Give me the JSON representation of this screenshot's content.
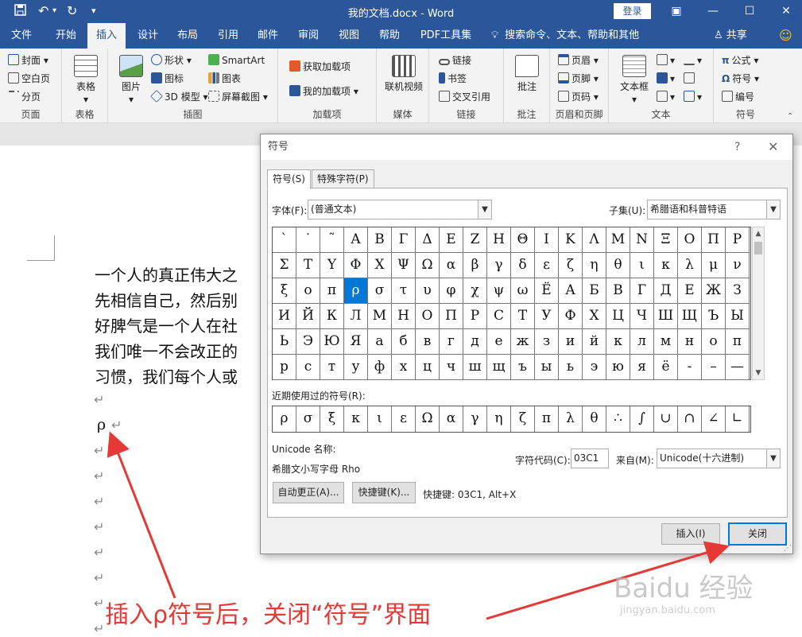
{
  "titlebar": {
    "document_title": "我的文档.docx  -  Word",
    "login_label": "登录",
    "save_icon": "save-icon",
    "undo_icon": "undo-icon",
    "redo_icon": "redo-icon",
    "qa_more": "▾",
    "ribbon_display": "▣",
    "minimize": "—",
    "maximize": "☐",
    "close": "✕"
  },
  "tabs": [
    "文件",
    "开始",
    "插入",
    "设计",
    "布局",
    "引用",
    "邮件",
    "审阅",
    "视图",
    "帮助",
    "PDF工具集"
  ],
  "tell_me": "搜索命令、文本、帮助和其他",
  "share_label": "共享",
  "ribbon": {
    "pages": {
      "label": "页面",
      "items": [
        "封面",
        "空白页",
        "分页"
      ]
    },
    "tables": {
      "label": "表格",
      "item": "表格"
    },
    "illustrations": {
      "label": "插图",
      "picture": "图片",
      "shapes": "形状",
      "icons": "图标",
      "model3d": "3D 模型",
      "smartart": "SmartArt",
      "chart": "图表",
      "screenshot": "屏幕截图"
    },
    "addins": {
      "label": "加载项",
      "get": "获取加载项",
      "mine": "我的加载项"
    },
    "media": {
      "label": "媒体",
      "video": "联机视频"
    },
    "links": {
      "label": "链接",
      "link": "链接",
      "bookmark": "书签",
      "crossref": "交叉引用"
    },
    "comments": {
      "label": "批注",
      "comment": "批注"
    },
    "header_footer": {
      "label": "页眉和页脚",
      "header": "页眉",
      "footer": "页脚",
      "page_number": "页码"
    },
    "text": {
      "label": "文本",
      "textbox": "文本框"
    },
    "symbols": {
      "label": "符号",
      "equation": "公式",
      "symbol": "符号",
      "number": "编号"
    }
  },
  "document": {
    "lines": [
      "一个人的真正伟大之",
      "先相信自己，然后别",
      "好脾气是一个人在社",
      "我们唯一不会改正的",
      "习惯，我们每个人或"
    ],
    "inserted_symbol": "ρ",
    "para_mark": "↵"
  },
  "dialog": {
    "title": "符号",
    "help": "?",
    "close": "✕",
    "tab_symbols": "符号(S)",
    "tab_special": "特殊字符(P)",
    "font_label": "字体(F):",
    "font_value": "(普通文本)",
    "subset_label": "子集(U):",
    "subset_value": "希腊语和科普特语",
    "symbols": [
      "`",
      "˙",
      "˜",
      "Α",
      "Β",
      "Γ",
      "Δ",
      "Ε",
      "Ζ",
      "Η",
      "Θ",
      "Ι",
      "Κ",
      "Λ",
      "Μ",
      "Ν",
      "Ξ",
      "Ο",
      "Π",
      "Ρ",
      "Σ",
      "Τ",
      "Υ",
      "Φ",
      "Χ",
      "Ψ",
      "Ω",
      "α",
      "β",
      "γ",
      "δ",
      "ε",
      "ζ",
      "η",
      "θ",
      "ι",
      "κ",
      "λ",
      "μ",
      "ν",
      "ξ",
      "ο",
      "π",
      "ρ",
      "σ",
      "τ",
      "υ",
      "φ",
      "χ",
      "ψ",
      "ω",
      "Ё",
      "А",
      "Б",
      "В",
      "Г",
      "Д",
      "Е",
      "Ж",
      "З",
      "И",
      "Й",
      "К",
      "Л",
      "М",
      "Н",
      "О",
      "П",
      "Р",
      "С",
      "Т",
      "У",
      "Ф",
      "Х",
      "Ц",
      "Ч",
      "Ш",
      "Щ",
      "Ъ",
      "Ы",
      "Ь",
      "Э",
      "Ю",
      "Я",
      "а",
      "б",
      "в",
      "г",
      "д",
      "е",
      "ж",
      "з",
      "и",
      "й",
      "к",
      "л",
      "м",
      "н",
      "о",
      "п",
      "р",
      "с",
      "т",
      "у",
      "ф",
      "х",
      "ц",
      "ч",
      "ш",
      "щ",
      "ъ",
      "ы",
      "ь",
      "э",
      "ю",
      "я",
      "ё",
      "‐",
      "–",
      "—"
    ],
    "selected_symbol": "ρ",
    "recent_label": "近期使用过的符号(R):",
    "recent": [
      "ρ",
      "σ",
      "ξ",
      "κ",
      "ι",
      "ε",
      "Ω",
      "α",
      "γ",
      "η",
      "ζ",
      "π",
      "λ",
      "θ",
      "∴",
      "∫",
      "∪",
      "∩",
      "∠",
      "∟"
    ],
    "unicode_name_label": "Unicode 名称:",
    "unicode_name": "希腊文小写字母 Rho",
    "char_code_label": "字符代码(C):",
    "char_code": "03C1",
    "from_label": "来自(M):",
    "from_value": "Unicode(十六进制)",
    "autocorrect_button": "自动更正(A)...",
    "shortcut_button": "快捷键(K)...",
    "shortcut_text": "快捷键: 03C1, Alt+X",
    "insert_button": "插入(I)",
    "close_button": "关闭"
  },
  "annotation": {
    "caption": "插入ρ符号后，关闭“符号”界面",
    "color": "#e53935"
  },
  "watermark": {
    "text": "Baidu 经验",
    "url": "jingyan.baidu.com"
  }
}
